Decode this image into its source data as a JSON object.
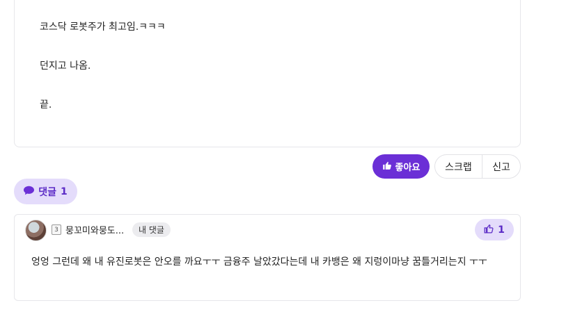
{
  "post": {
    "lines": [
      "코스닥 로봇주가 최고임.ㅋㅋㅋ",
      "던지고 나옴.",
      "끝."
    ]
  },
  "actions": {
    "like_label": "좋아요",
    "scrap_label": "스크랩",
    "report_label": "신고"
  },
  "comments_toggle": {
    "label": "댓글",
    "count": "1"
  },
  "comment": {
    "level": "3",
    "author": "뭉꼬미와뭉도...",
    "badge": "내 댓글",
    "like_count": "1",
    "text": "엉엉 그런데 왜 내 유진로봇은 안오를 까요ㅜㅜ 금융주 날았갔다는데 내 카뱅은 왜 지렁이마냥 꿈틀거리는지 ㅜㅜ"
  },
  "colors": {
    "accent": "#6b2fd6",
    "accent_light": "#e4dcfb",
    "accent_text": "#5b2bc6"
  },
  "icons": [
    "thumbs-up-icon",
    "speech-bubble-icon",
    "level-badge-icon"
  ]
}
